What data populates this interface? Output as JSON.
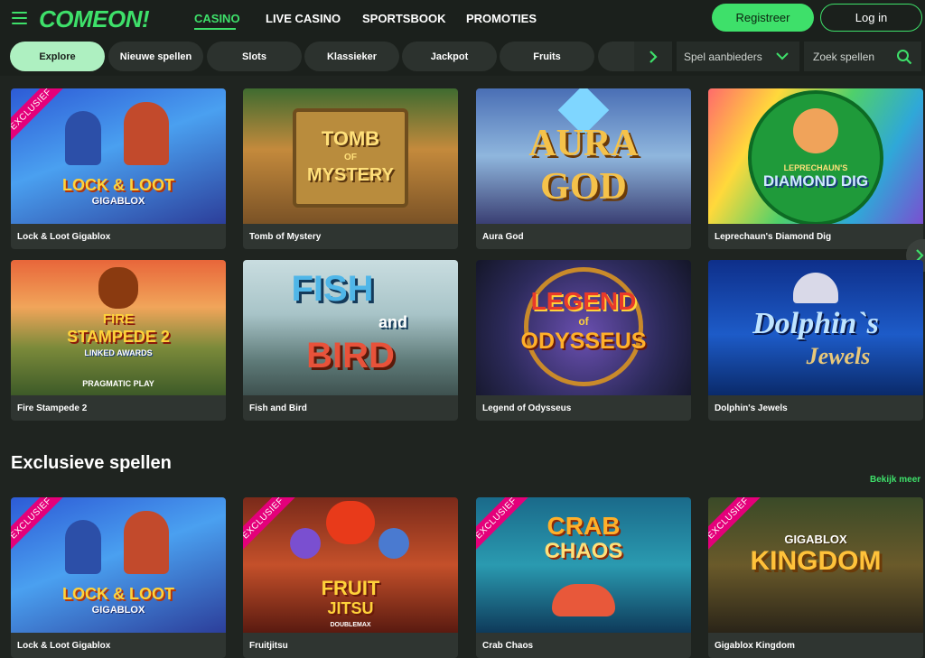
{
  "header": {
    "logo": "COMEON!",
    "nav": [
      "CASINO",
      "LIVE CASINO",
      "SPORTSBOOK",
      "PROMOTIES"
    ],
    "register_label": "Registreer",
    "login_label": "Log in"
  },
  "filters": {
    "chips": [
      "Explore",
      "Nieuwe spellen",
      "Slots",
      "Klassieker",
      "Jackpot",
      "Fruits"
    ],
    "providers_label": "Spel aanbieders",
    "search_placeholder": "Zoek spellen"
  },
  "games": [
    {
      "name": "Lock & Loot Gigablox",
      "art": [
        "LOCK & LOOT",
        "GIGABLOX"
      ],
      "exclusive": true
    },
    {
      "name": "Tomb of Mystery",
      "art": [
        "TOMB",
        "OF",
        "MYSTERY"
      ],
      "exclusive": false
    },
    {
      "name": "Aura God",
      "art": [
        "AURA",
        "GOD"
      ],
      "exclusive": false
    },
    {
      "name": "Leprechaun's Diamond Dig",
      "art": [
        "LEPRECHAUN'S",
        "DIAMOND DIG"
      ],
      "exclusive": false
    },
    {
      "name": "Fire Stampede 2",
      "art": [
        "FIRE",
        "STAMPEDE 2",
        "LINKED AWARDS",
        "PRAGMATIC PLAY"
      ],
      "exclusive": false
    },
    {
      "name": "Fish and Bird",
      "art": [
        "FISH",
        "and",
        "BIRD"
      ],
      "exclusive": false
    },
    {
      "name": "Legend of Odysseus",
      "art": [
        "LEGEND",
        "of",
        "ODYSSEUS"
      ],
      "exclusive": false
    },
    {
      "name": "Dolphin's Jewels",
      "art": [
        "Dolphin`s",
        "Jewels"
      ],
      "exclusive": false
    }
  ],
  "exclusive_section": {
    "title": "Exclusieve spellen",
    "see_more": "Bekijk meer",
    "ribbon": "EXCLUSIEF",
    "games": [
      {
        "name": "Lock & Loot Gigablox",
        "art": [
          "LOCK & LOOT",
          "GIGABLOX"
        ]
      },
      {
        "name": "Fruitjitsu",
        "art": [
          "FRUIT",
          "JITSU",
          "DOUBLEMAX"
        ]
      },
      {
        "name": "Crab Chaos",
        "art": [
          "CRAB",
          "CHAOS"
        ]
      },
      {
        "name": "Gigablox Kingdom",
        "art": [
          "GIGABLOX",
          "KINGDOM"
        ]
      }
    ]
  },
  "colors": {
    "accent": "#3ee06a",
    "background": "#1f2420",
    "ribbon": "#e4007a"
  }
}
